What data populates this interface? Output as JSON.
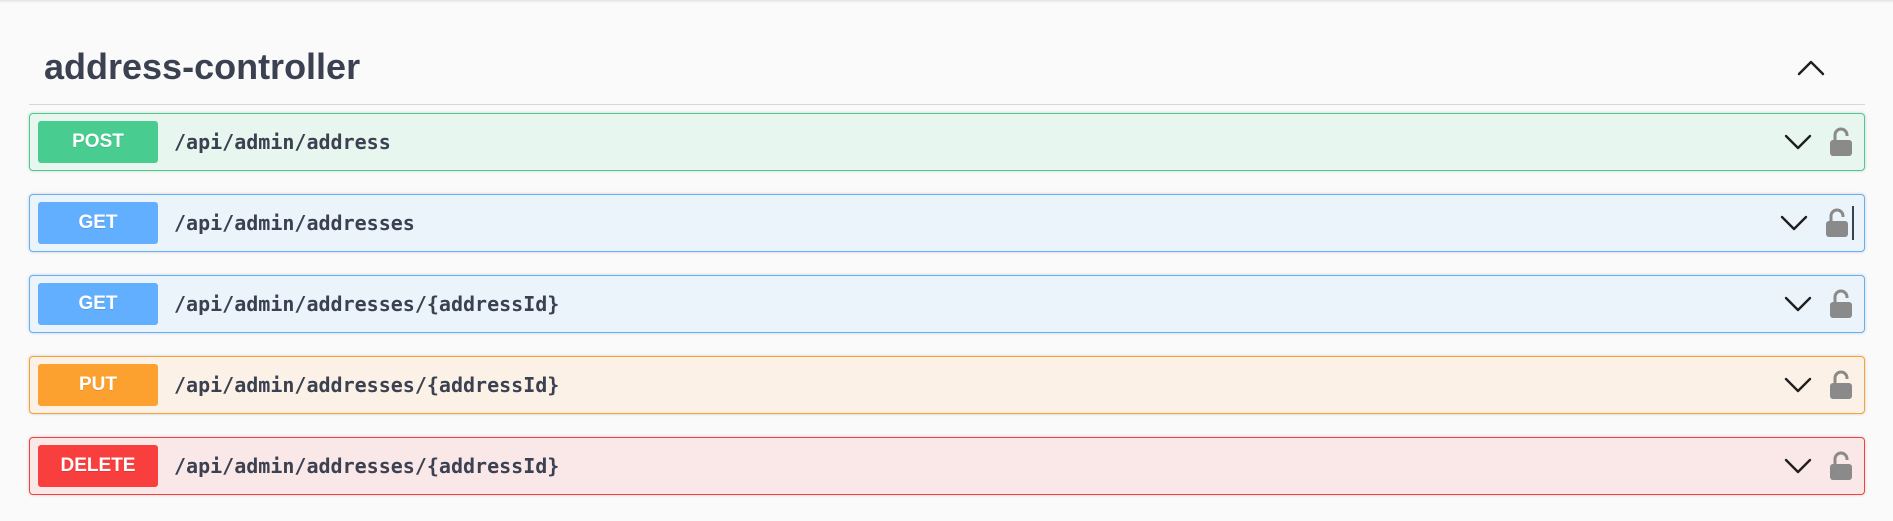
{
  "tag": {
    "title": "address-controller"
  },
  "operations": [
    {
      "method": "POST",
      "path": "/api/admin/address"
    },
    {
      "method": "GET",
      "path": "/api/admin/addresses"
    },
    {
      "method": "GET",
      "path": "/api/admin/addresses/{addressId}"
    },
    {
      "method": "PUT",
      "path": "/api/admin/addresses/{addressId}"
    },
    {
      "method": "DELETE",
      "path": "/api/admin/addresses/{addressId}"
    }
  ],
  "icons": {
    "collapse": "chevron-up-icon",
    "expand": "chevron-down-icon",
    "auth": "unlocked-padlock-icon"
  },
  "colors": {
    "post": "#49cc90",
    "get": "#61affe",
    "put": "#fca130",
    "delete": "#f93e3e",
    "text": "#3b4151"
  }
}
